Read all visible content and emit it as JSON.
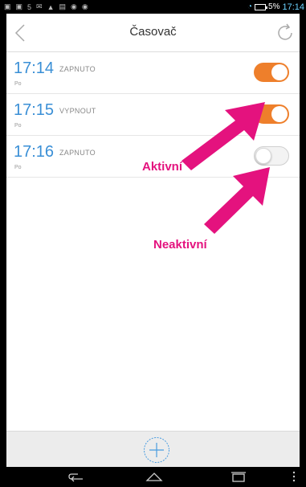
{
  "status_bar": {
    "battery": "5%",
    "time": "17:14"
  },
  "header": {
    "title": "Časovač"
  },
  "timers": [
    {
      "time": "17:14",
      "action": "ZAPNUTO",
      "day": "Po",
      "enabled": true
    },
    {
      "time": "17:15",
      "action": "VYPNOUT",
      "day": "Po",
      "enabled": true
    },
    {
      "time": "17:16",
      "action": "ZAPNUTO",
      "day": "Po",
      "enabled": false
    }
  ],
  "annotations": {
    "active": "Aktivní",
    "inactive": "Neaktivní",
    "color": "#e4127e"
  },
  "colors": {
    "accent": "#3a8fd6",
    "toggle_on": "#ee7f2b"
  },
  "icons": [
    "back-arrow-icon",
    "refresh-icon",
    "add-icon",
    "nav-back-icon",
    "nav-home-icon",
    "nav-recents-icon",
    "nav-menu-icon"
  ]
}
